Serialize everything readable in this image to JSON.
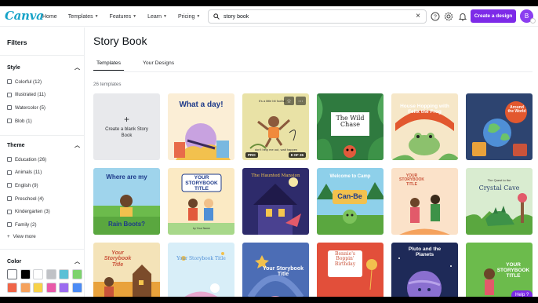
{
  "brand": {
    "logo": "Canva",
    "accent": "#7d2ae8",
    "logo_color": "#16a3c8"
  },
  "nav": [
    {
      "label": "Home",
      "chevron": false
    },
    {
      "label": "Templates",
      "chevron": true
    },
    {
      "label": "Features",
      "chevron": true
    },
    {
      "label": "Learn",
      "chevron": true
    },
    {
      "label": "Pricing",
      "chevron": true
    }
  ],
  "search": {
    "value": "story book",
    "placeholder": "Search"
  },
  "header": {
    "create_label": "Create a design",
    "avatar_initial": "B"
  },
  "sidebar": {
    "title": "Filters",
    "style": {
      "heading": "Style",
      "items": [
        "Colorful (12)",
        "Illustrated (11)",
        "Watercolor (5)",
        "Blob (1)"
      ]
    },
    "theme": {
      "heading": "Theme",
      "items": [
        "Education (26)",
        "Animals (11)",
        "English (9)",
        "Preschool (4)",
        "Kindergarten (3)",
        "Family (2)"
      ],
      "view_more": "View more"
    },
    "color": {
      "heading": "Color",
      "swatches": [
        "#ffffff",
        "#000000",
        "#ffffff",
        "#c0c2c6",
        "#5bc0d6",
        "#7dd36d",
        "#f06548",
        "#f5a25d",
        "#f7d24a",
        "#e95aa9",
        "#9b6cf0",
        "#4b8bf5"
      ]
    }
  },
  "main": {
    "title": "Story Book",
    "tabs": [
      "Templates",
      "Your Designs"
    ],
    "count": "26 templates",
    "blank_label": "Create a blank Story Book"
  },
  "cards": {
    "c1": {
      "title": "What a day!"
    },
    "c2": {
      "top": "It's a little bit foolish",
      "bottom": "don't help me out, wait happen",
      "pro": "PRO",
      "pages": "8 OF 26"
    },
    "c3": {
      "title": "The Wild Chase"
    },
    "c4": {
      "title": "House Hopping with Felix the Frog"
    },
    "c5": {
      "title": "Around the World"
    },
    "c6": {
      "title": "Where are my",
      "subtitle": "Rain Boots?"
    },
    "c7": {
      "title": "YOUR STORYBOOK TITLE",
      "author": "by Your Name"
    },
    "c8": {
      "title": "The Haunted Mansion"
    },
    "c9": {
      "title": "Welcome to Camp",
      "subtitle": "Can-Be"
    },
    "c10": {
      "title": "YOUR STORYBOOK TITLE"
    },
    "c11": {
      "title": "The Quest to the",
      "subtitle": "Crystal Cave"
    },
    "c12": {
      "title": "Your Storybook Title"
    },
    "c13": {
      "title": "Your Storybook Title"
    },
    "c14": {
      "title": "Your Storybook Title"
    },
    "c15": {
      "title": "Bennie's Boppin' Birthday"
    },
    "c16": {
      "title": "Pluto and the Planets"
    },
    "c17": {
      "title": "YOUR STORYBOOK TITLE"
    }
  },
  "help": "Help ?"
}
